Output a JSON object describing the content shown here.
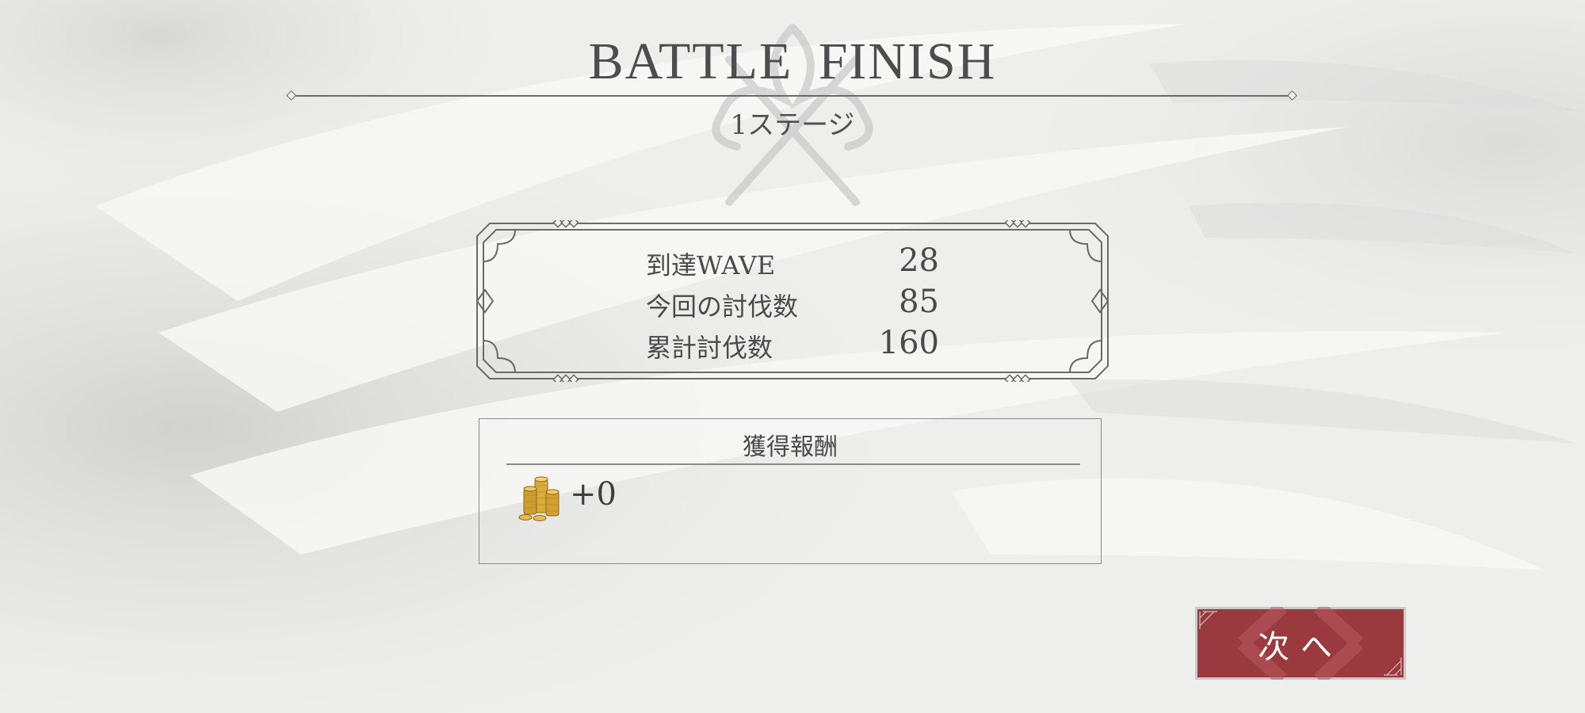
{
  "header": {
    "title": "BATTLE FINISH",
    "stage": "1ステージ"
  },
  "stats": [
    {
      "label": "到達WAVE",
      "value": "28"
    },
    {
      "label": "今回の討伐数",
      "value": "85"
    },
    {
      "label": "累計討伐数",
      "value": "160"
    }
  ],
  "rewards": {
    "title": "獲得報酬",
    "items": [
      {
        "icon": "gold-coins-icon",
        "amount": "+0"
      }
    ]
  },
  "next_button": {
    "label": "次へ"
  },
  "colors": {
    "background": "#eeeeec",
    "text": "#4a4a4c",
    "frame": "#6a6a6c",
    "button": "#9b3a3e",
    "gold": "#d4a537"
  }
}
